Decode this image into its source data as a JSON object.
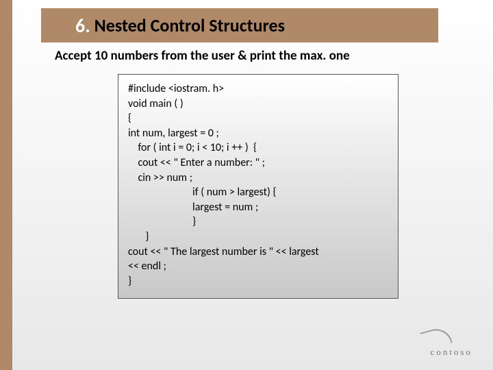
{
  "header": {
    "number": "6.",
    "title": " Nested Control Structures"
  },
  "subtitle": "Accept 10 numbers from the user & print the max. one",
  "code": {
    "l1": "#include <iostram. h>",
    "l2": "void main ( )",
    "l3": "{",
    "l4": "int num, largest = 0 ;",
    "l5": "    for ( int i = 0; i < 10; i ++ )  {",
    "l6": "    cout << \" Enter a number: \" ;",
    "l7": "    cin >> num ;",
    "l8": "                          if ( num > largest) {",
    "l9": "                          largest = num ;",
    "l10": "                          }",
    "l11": "       }",
    "l12": "cout << \" The largest number is \" << largest",
    "l13": "<< endl ;",
    "l14": "}"
  },
  "logo": "contoso"
}
